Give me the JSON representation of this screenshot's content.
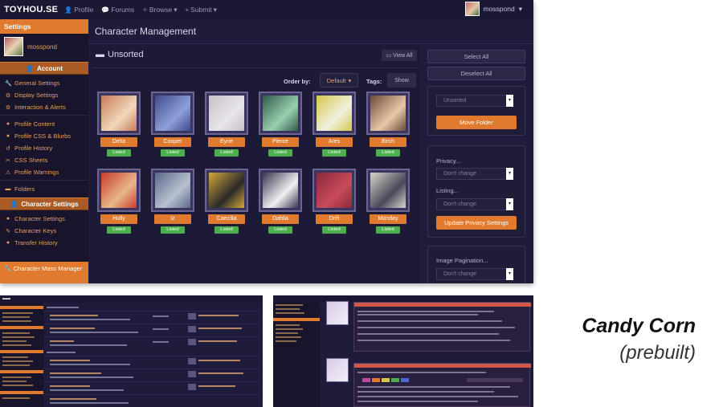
{
  "nav": {
    "brand": "TOYHOU.SE",
    "links": [
      "Profile",
      "Forums",
      "Browse",
      "Submit"
    ],
    "username": "mosspond"
  },
  "sidebar": {
    "header": "Settings",
    "username": "mosspond",
    "sections": {
      "account": "Account",
      "character_settings": "Character Settings"
    },
    "items_account": [
      "General Settings",
      "Display Settings",
      "Interaction & Alerts"
    ],
    "items_profile": [
      "Profile Content",
      "Profile CSS & Blurbs",
      "Profile History",
      "CSS Sheets",
      "Profile Warnings"
    ],
    "folders": "Folders",
    "items_character": [
      "Character Settings",
      "Character Keys",
      "Transfer History"
    ],
    "active": "Character Mass Manager"
  },
  "main": {
    "title": "Character Management",
    "folder": "Unsorted",
    "view_all": "View All",
    "order_by_label": "Order by:",
    "order_by_value": "Default",
    "tags_label": "Tags:",
    "show_button": "Show"
  },
  "characters": [
    {
      "name": "Delta",
      "status": "Listed",
      "colors": [
        "#c87a5a",
        "#f0d8b8"
      ]
    },
    {
      "name": "Cooper",
      "status": "Listed",
      "colors": [
        "#3d4a8c",
        "#8fa0d8"
      ]
    },
    {
      "name": "Eyrie",
      "status": "Listed",
      "colors": [
        "#c8c0c8",
        "#e8e4ec"
      ]
    },
    {
      "name": "Pierce",
      "status": "Listed",
      "colors": [
        "#2f5b4a",
        "#9ad0b0"
      ]
    },
    {
      "name": "Ares",
      "status": "Listed",
      "colors": [
        "#d4c84a",
        "#f0f0e0"
      ]
    },
    {
      "name": "Birch",
      "status": "Listed",
      "colors": [
        "#6b4a3a",
        "#e8c8a8"
      ]
    },
    {
      "name": "Holly",
      "status": "Listed",
      "colors": [
        "#c83a2a",
        "#e8b888"
      ]
    },
    {
      "name": "Iz",
      "status": "Listed",
      "colors": [
        "#5a6a8a",
        "#b8c0d0"
      ]
    },
    {
      "name": "Caecilia",
      "status": "Listed",
      "colors": [
        "#d4a83a",
        "#2a2a2a"
      ]
    },
    {
      "name": "Dahlia",
      "status": "Listed",
      "colors": [
        "#3a3450",
        "#f0f0f0"
      ]
    },
    {
      "name": "Drift",
      "status": "Listed",
      "colors": [
        "#8a2a3a",
        "#c84a5a"
      ]
    },
    {
      "name": "Monday",
      "status": "Listed",
      "colors": [
        "#d8d4cc",
        "#4a4a5a"
      ]
    }
  ],
  "right_panel": {
    "select_all": "Select All",
    "deselect_all": "Deselect All",
    "folder_select": "Unsorted",
    "move_folder": "Move Folder",
    "privacy_label": "Privacy...",
    "privacy_value": "Don't change",
    "listing_label": "Listing...",
    "listing_value": "Don't change",
    "update_privacy": "Update Privacy Settings",
    "pagination_label": "Image Pagination...",
    "pagination_value": "Don't change"
  },
  "caption": {
    "title": "Candy Corn",
    "subtitle": "(prebuilt)"
  },
  "colors": {
    "accent": "#e07a2e",
    "background": "#1f1b3a",
    "sidebar": "#17142c",
    "badge": "#4cae4c"
  }
}
